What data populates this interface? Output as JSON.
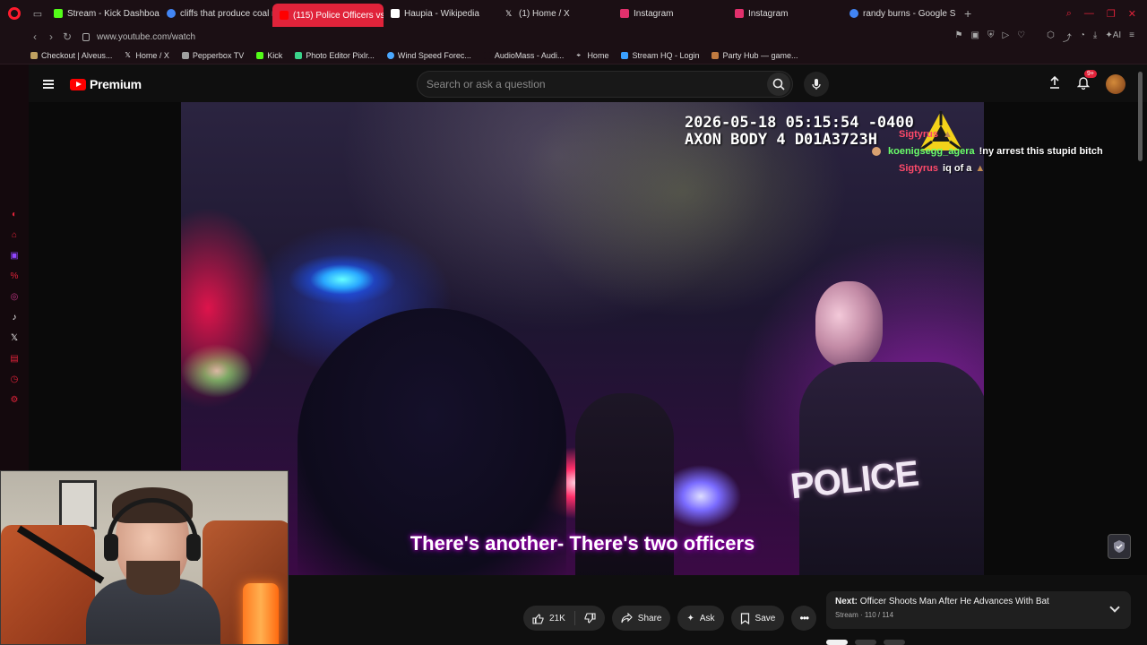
{
  "browser": {
    "tabs": [
      {
        "label": "Stream - Kick Dashboard",
        "icon": "kick-icon",
        "color": "#53fc18"
      },
      {
        "label": "cliffs that produce coal nat",
        "icon": "google-icon",
        "color": "#4285f4"
      },
      {
        "label": "(115) Police Officers vs",
        "icon": "youtube-icon",
        "color": "#ff0000",
        "active": true
      },
      {
        "label": "Haupia - Wikipedia",
        "icon": "wikipedia-icon",
        "color": "#ffffff"
      },
      {
        "label": "(1) Home / X",
        "icon": "x-icon",
        "color": "#ffffff"
      },
      {
        "label": "Instagram",
        "icon": "instagram-icon",
        "color": "#e1306c"
      },
      {
        "label": "Instagram",
        "icon": "instagram-icon",
        "color": "#e1306c"
      },
      {
        "label": "randy burns - Google Sear",
        "icon": "google-icon",
        "color": "#4285f4"
      }
    ],
    "url": "www.youtube.com/watch",
    "bookmarks": [
      {
        "label": "Checkout | Alveus...",
        "icon": "bookmark-icon",
        "color": "#c0a060"
      },
      {
        "label": "Home / X",
        "icon": "x-icon",
        "color": "#ffffff"
      },
      {
        "label": "Pepperbox TV",
        "icon": "pepperbox-icon",
        "color": "#a0a0a0"
      },
      {
        "label": "Kick",
        "icon": "kick-icon",
        "color": "#53fc18"
      },
      {
        "label": "Photo Editor Pixlr...",
        "icon": "pixlr-icon",
        "color": "#3ad38a"
      },
      {
        "label": "Wind Speed Forec...",
        "icon": "weather-icon",
        "color": "#4aa8ff"
      },
      {
        "label": "AudioMass - Audi...",
        "icon": "audio-icon",
        "color": "#1b0f14"
      },
      {
        "label": "Home",
        "icon": "location-icon",
        "color": "#ffffff"
      },
      {
        "label": "Stream HQ - Login",
        "icon": "streamhq-icon",
        "color": "#3aa0ff"
      },
      {
        "label": "Party Hub — game...",
        "icon": "party-icon",
        "color": "#c07a40"
      }
    ]
  },
  "youtube": {
    "brand": "Premium",
    "search_placeholder": "Search or ask a question",
    "notif_count": "9+"
  },
  "video": {
    "timestamp": "2026-05-18 05:15:54 -0400",
    "device": "AXON BODY 4 D01A3723H",
    "subtitle": "There's another- There's two officers",
    "vest_text": "POLICE"
  },
  "chat": [
    {
      "user": "Sigtyrus",
      "message": "",
      "color": "#ff4a6a"
    },
    {
      "user": "koenigsegg_agera",
      "message": "!ny arrest this stupid bitch",
      "color": "#6aff6a"
    },
    {
      "user": "Sigtyrus",
      "message": "iq of a",
      "color": "#ff4a6a"
    }
  ],
  "actions": {
    "likes": "21K",
    "share": "Share",
    "ask": "Ask",
    "save": "Save"
  },
  "next": {
    "prefix": "Next:",
    "title": "Officer Shoots Man After He Advances With Bat",
    "sub": "Stream · 110 / 114"
  },
  "colors": {
    "accent": "#ff0033",
    "opera": "#ff1b2d",
    "active_tab": "#e0233a"
  }
}
